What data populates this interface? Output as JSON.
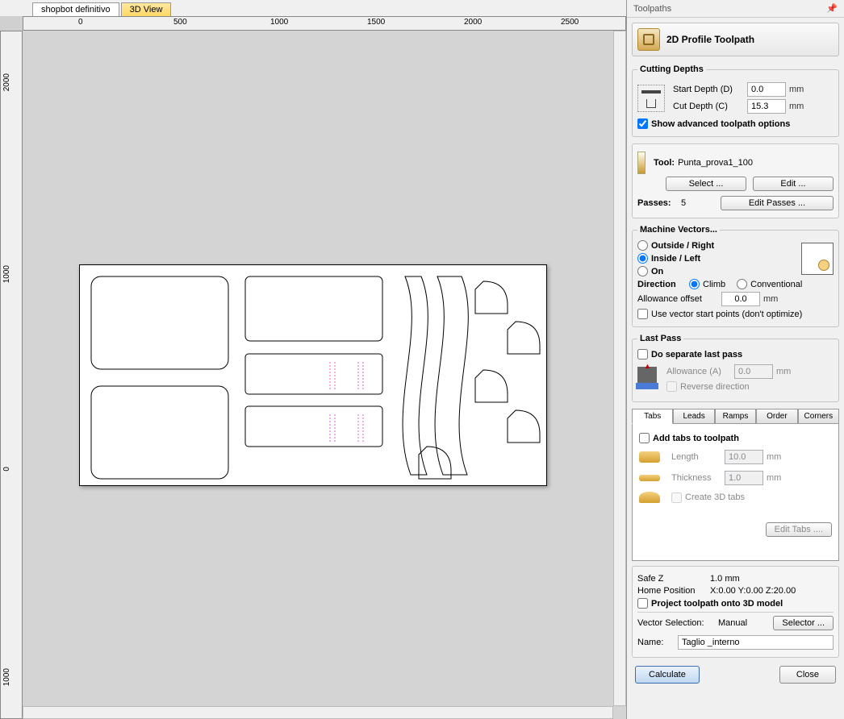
{
  "tabs": {
    "design": "shopbot definitivo",
    "view3d": "3D View"
  },
  "ruler": {
    "h": [
      "0",
      "500",
      "1000",
      "1500",
      "2000",
      "2500"
    ],
    "v": [
      "2000",
      "1000",
      "0",
      "1000"
    ]
  },
  "sidebar": {
    "header": "Toolpaths",
    "title": "2D Profile Toolpath",
    "cutting": {
      "title": "Cutting Depths",
      "start_label": "Start Depth (D)",
      "start_val": "0.0",
      "start_unit": "mm",
      "cut_label": "Cut Depth (C)",
      "cut_val": "15.3",
      "cut_unit": "mm",
      "adv_label": "Show advanced toolpath options"
    },
    "tool": {
      "label": "Tool:",
      "name": "Punta_prova1_100",
      "select": "Select ...",
      "edit": "Edit ...",
      "passes_label": "Passes:",
      "passes_val": "5",
      "edit_passes": "Edit Passes ..."
    },
    "mv": {
      "title": "Machine Vectors...",
      "outside": "Outside / Right",
      "inside": "Inside / Left",
      "on": "On",
      "dir_label": "Direction",
      "climb": "Climb",
      "conv": "Conventional",
      "allow_label": "Allowance offset",
      "allow_val": "0.0",
      "allow_unit": "mm",
      "usevec": "Use vector start points (don't optimize)"
    },
    "last": {
      "title": "Last Pass",
      "sep": "Do separate last pass",
      "allow_label": "Allowance (A)",
      "allow_val": "0.0",
      "allow_unit": "mm",
      "rev": "Reverse direction"
    },
    "subtabs": {
      "tabs": "Tabs",
      "leads": "Leads",
      "ramps": "Ramps",
      "order": "Order",
      "corners": "Corners",
      "add": "Add tabs to toolpath",
      "len_label": "Length",
      "len_val": "10.0",
      "len_unit": "mm",
      "thk_label": "Thickness",
      "thk_val": "1.0",
      "thk_unit": "mm",
      "c3d": "Create 3D tabs",
      "edit": "Edit Tabs ...."
    },
    "safez_label": "Safe Z",
    "safez_val": "1.0 mm",
    "home_label": "Home Position",
    "home_val": "X:0.00 Y:0.00 Z:20.00",
    "project": "Project toolpath onto 3D model",
    "vecsel_label": "Vector Selection:",
    "vecsel_val": "Manual",
    "selector": "Selector ...",
    "name_label": "Name:",
    "name_val": "Taglio _interno",
    "calc": "Calculate",
    "close": "Close"
  }
}
